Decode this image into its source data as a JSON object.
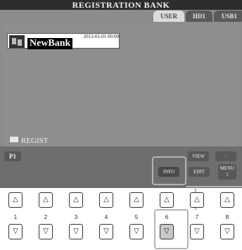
{
  "screen": {
    "title": "REGISTRATION BANK",
    "tabs": [
      {
        "label": "USER",
        "active": true
      },
      {
        "label": "HD1",
        "active": false
      },
      {
        "label": "USB1",
        "active": false
      }
    ],
    "bank": {
      "date": "2013-01-01 00:00",
      "name": "NewBank",
      "icon": "registration-bank-icon"
    },
    "folder_label": "REGIST",
    "page_button": "P1",
    "buttons": {
      "view": "VIEW",
      "info": "INFO",
      "edit": "EDIT",
      "menu_line1": "MENU",
      "menu_line2": "1"
    }
  },
  "hardware_buttons": {
    "numbers": [
      "1",
      "2",
      "3",
      "4",
      "5",
      "6",
      "7",
      "8"
    ],
    "up_symbol": "△",
    "down_symbol": "▽",
    "highlighted": "6"
  },
  "colors": {
    "screen_bg": "#8c8c8c",
    "title_bg": "#2d2d2d",
    "callout": "#b4b4b4"
  }
}
